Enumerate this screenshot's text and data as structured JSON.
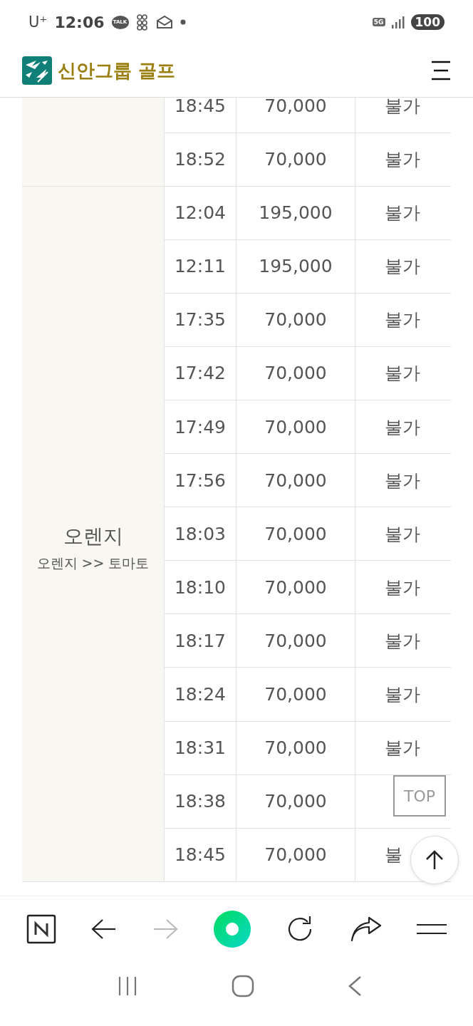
{
  "status_bar": {
    "carrier": "U⁺",
    "time": "12:06",
    "talk_badge": "TALK",
    "network": "5G",
    "battery": "100"
  },
  "header": {
    "title": "신안그룹 골프"
  },
  "table": {
    "groups": [
      {
        "rows": [
          {
            "time": "18:45",
            "price": "70,000",
            "status": "불가"
          },
          {
            "time": "18:52",
            "price": "70,000",
            "status": "불가"
          }
        ]
      },
      {
        "name": "오렌지",
        "route": "오렌지 >> 토마토",
        "rows": [
          {
            "time": "12:04",
            "price": "195,000",
            "status": "불가"
          },
          {
            "time": "12:11",
            "price": "195,000",
            "status": "불가"
          },
          {
            "time": "17:35",
            "price": "70,000",
            "status": "불가"
          },
          {
            "time": "17:42",
            "price": "70,000",
            "status": "불가"
          },
          {
            "time": "17:49",
            "price": "70,000",
            "status": "불가"
          },
          {
            "time": "17:56",
            "price": "70,000",
            "status": "불가"
          },
          {
            "time": "18:03",
            "price": "70,000",
            "status": "불가"
          },
          {
            "time": "18:10",
            "price": "70,000",
            "status": "불가"
          },
          {
            "time": "18:17",
            "price": "70,000",
            "status": "불가"
          },
          {
            "time": "18:24",
            "price": "70,000",
            "status": "불가"
          },
          {
            "time": "18:31",
            "price": "70,000",
            "status": "불가"
          },
          {
            "time": "18:38",
            "price": "70,000"
          },
          {
            "time": "18:45",
            "price": "70,000",
            "status": "불"
          }
        ]
      }
    ]
  },
  "top_button": {
    "label": "TOP"
  },
  "browser_bar": {
    "forward_disabled": true
  }
}
